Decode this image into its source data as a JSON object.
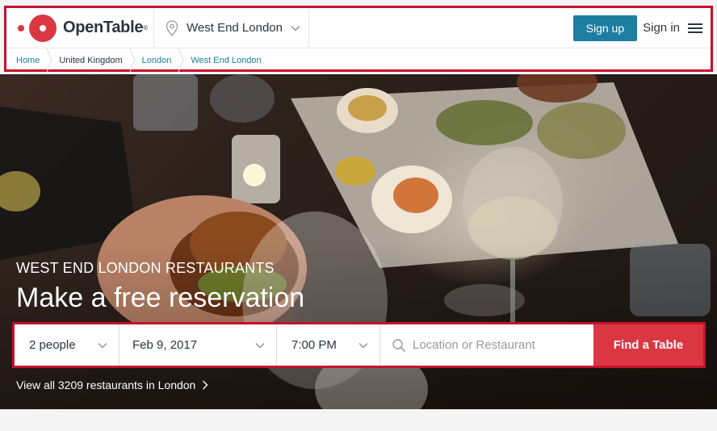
{
  "header": {
    "logo_text": "OpenTable",
    "logo_reg": "®",
    "location": "West End London",
    "signup_label": "Sign up",
    "signin_label": "Sign in"
  },
  "breadcrumb": [
    {
      "label": "Home",
      "link": true
    },
    {
      "label": "United Kingdom",
      "link": false
    },
    {
      "label": "London",
      "link": true
    },
    {
      "label": "West End London",
      "link": true
    }
  ],
  "hero": {
    "subtitle": "WEST END LONDON RESTAURANTS",
    "title": "Make a free reservation"
  },
  "search": {
    "party_size": "2 people",
    "date": "Feb 9, 2017",
    "time": "7:00 PM",
    "location_placeholder": "Location or Restaurant",
    "submit_label": "Find a Table"
  },
  "view_all_label": "View all 3209 restaurants in London",
  "colors": {
    "brand_red": "#da3743",
    "link_blue": "#1e7ea0",
    "highlight_border": "#c8102e"
  },
  "icons": [
    "opentable-logo-icon",
    "location-pin-icon",
    "chevron-down-icon",
    "menu-icon",
    "search-icon",
    "chevron-right-icon"
  ]
}
